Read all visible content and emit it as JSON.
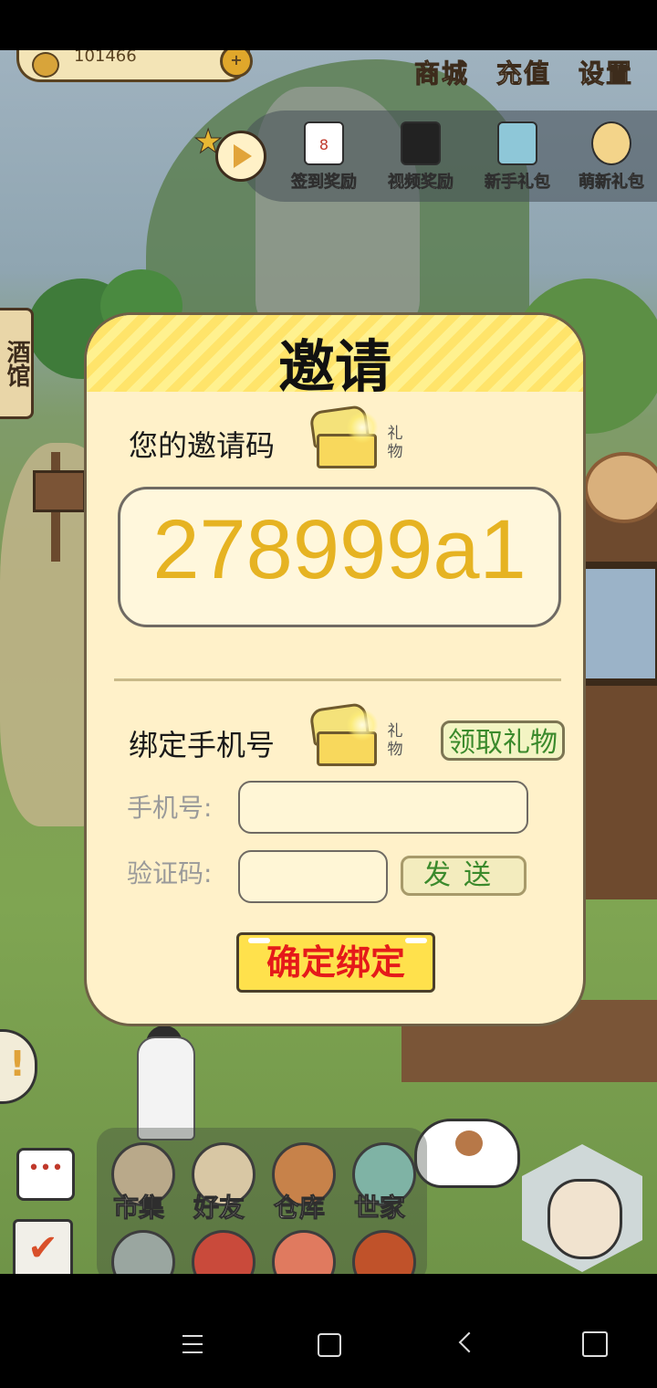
{
  "hud": {
    "coins": "101466",
    "menu": [
      "商城",
      "充值",
      "设置"
    ],
    "rewards": [
      "签到奖励",
      "视频奖励",
      "新手礼包",
      "萌新礼包"
    ],
    "reward_day": "8"
  },
  "left_sign": "酒馆",
  "modal": {
    "title": "邀请",
    "invite_label": "您的邀请码",
    "gift_label": "礼物",
    "invite_code": "278999a1",
    "bind_label": "绑定手机号",
    "claim_button": "领取礼物",
    "phone_label": "手机号:",
    "phone_value": "",
    "code_label": "验证码:",
    "code_value": "",
    "send_button": "发送",
    "confirm_button": "确定绑定"
  },
  "bottom": {
    "buttons": [
      "市集",
      "好友",
      "仓库",
      "世家"
    ]
  },
  "colors": {
    "modal_bg": "#fff1c9",
    "header_yellow": "#ffe46a",
    "code_text": "#e6b322",
    "confirm_text": "#e51a1a",
    "green_text": "#3b8a2c"
  }
}
